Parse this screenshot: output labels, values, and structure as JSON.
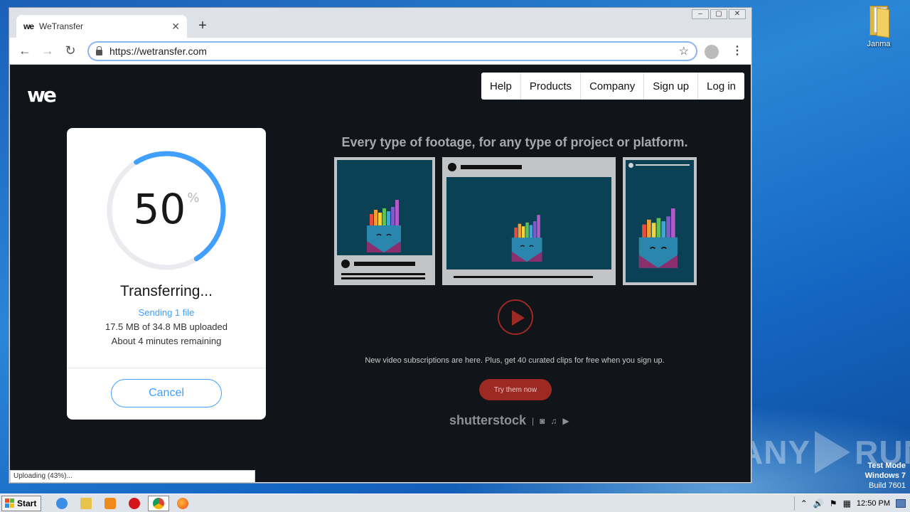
{
  "browser": {
    "tab_title": "WeTransfer",
    "tab_favicon": "we",
    "close_glyph": "✕",
    "newtab_glyph": "+",
    "url": "https://wetransfer.com",
    "nav": {
      "back": "←",
      "forward": "→",
      "reload": "↻"
    },
    "star": "☆",
    "menu": "⋮",
    "window_controls": [
      "–",
      "▢",
      "✕"
    ],
    "status_text": "Uploading (43%)..."
  },
  "site": {
    "logo": "we",
    "nav": [
      "Help",
      "Products",
      "Company",
      "Sign up",
      "Log in"
    ],
    "transfer": {
      "progress_percent": 50,
      "percent_value": "50",
      "percent_sign": "%",
      "title": "Transferring...",
      "sending": "Sending 1 file",
      "uploaded": "17.5 MB of 34.8 MB uploaded",
      "remaining": "About 4 minutes remaining",
      "cancel": "Cancel",
      "accent": "#409fff"
    },
    "ad": {
      "headline": "Every type of footage, for any type of project or platform.",
      "text": "New video subscriptions are here. Plus, get 40 curated clips for free when you sign up.",
      "cta": "Try them now",
      "brand": "shutterstock",
      "brand_icons": [
        "camera-icon",
        "music-icon",
        "video-icon"
      ],
      "accent": "#9c2a23"
    }
  },
  "desktop": {
    "icon_label": "Janma",
    "watermark": "ANY RUN",
    "watermark_left": "ANY",
    "watermark_right": "RUN",
    "test_mode": "Test Mode",
    "os": "Windows 7",
    "build": "Build 7601"
  },
  "taskbar": {
    "start": "Start",
    "clock": "12:50 PM",
    "apps": [
      "ie-icon",
      "explorer-icon",
      "media-player-icon",
      "opera-icon",
      "chrome-icon",
      "firefox-icon"
    ]
  }
}
